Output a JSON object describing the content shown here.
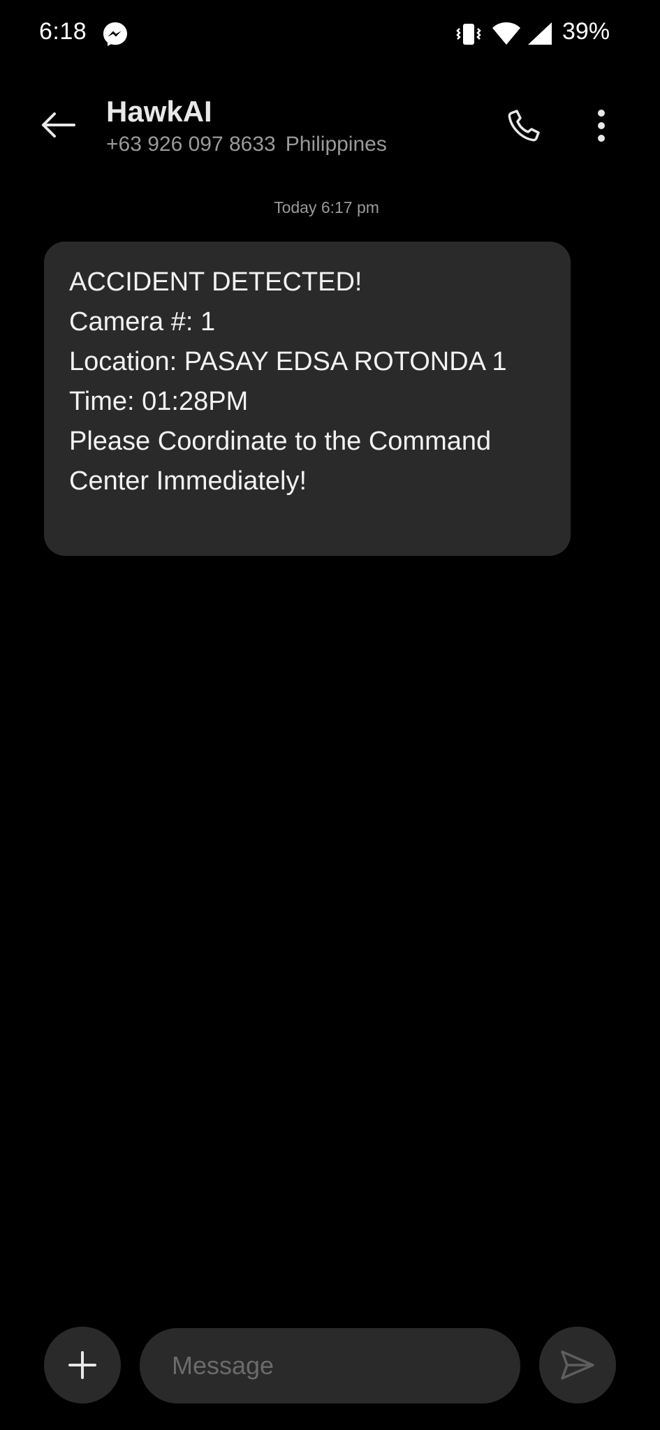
{
  "status_bar": {
    "time": "6:18",
    "battery": "39%",
    "icons": [
      "messenger-icon",
      "vibrate-icon",
      "wifi-icon",
      "signal-icon"
    ]
  },
  "header": {
    "contact_name": "HawkAI",
    "phone_number": "+63 926 097 8633",
    "country": "Philippines",
    "icons": [
      "back-arrow-icon",
      "phone-icon",
      "more-vert-icon"
    ]
  },
  "conversation": {
    "date_stamp": "Today 6:17 pm",
    "messages": [
      {
        "lines": [
          "ACCIDENT DETECTED!",
          "Camera #: 1",
          "Location: PASAY EDSA ROTONDA 1",
          "Time: 01:28PM",
          "Please Coordinate to the Command",
          "Center Immediately!"
        ]
      }
    ]
  },
  "composer": {
    "placeholder": "Message",
    "value": "",
    "icons": [
      "plus-icon",
      "send-icon"
    ]
  },
  "colors": {
    "background": "#000000",
    "bubble": "#2a2a2a",
    "primary_text": "#f2f2f2",
    "secondary_text": "#9a9a9a",
    "placeholder_text": "#6b6b6b"
  }
}
